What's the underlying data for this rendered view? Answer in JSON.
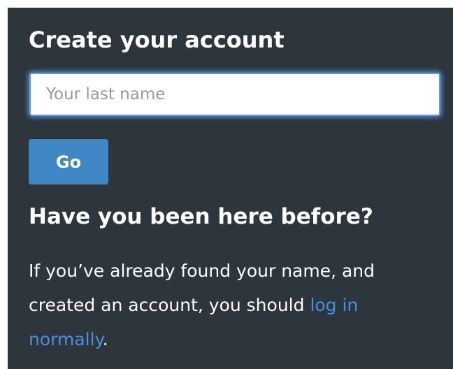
{
  "form": {
    "title": "Create your account",
    "last_name_placeholder": "Your last name",
    "last_name_value": "",
    "go_label": "Go"
  },
  "returning": {
    "title": "Have you been here before?",
    "text_before": "If you’ve already found your name, and created an account, you should ",
    "login_link_label": "log in normally",
    "text_after": "."
  },
  "colors": {
    "panel_background": "#2d353d",
    "button_background": "#3f87c5",
    "link": "#4a90d9",
    "focus_ring": "#5c9ee0"
  }
}
